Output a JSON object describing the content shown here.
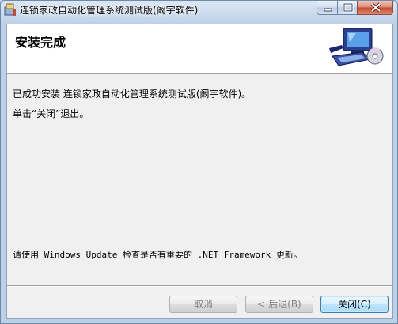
{
  "window": {
    "title": "连锁家政自动化管理系统测试版(阚宇软件)"
  },
  "banner": {
    "title": "安装完成"
  },
  "content": {
    "line1": "已成功安装 连锁家政自动化管理系统测试版(阚宇软件)。",
    "line2": "单击“关闭”退出。",
    "line3_prefix": "请使用 Windows Update 检查是否有重要的 .NET Framework 更新。"
  },
  "buttons": {
    "cancel": "取消",
    "back": "< 后退(B)",
    "close": "关闭(C)"
  },
  "icons": {
    "app": "installer-icon",
    "banner": "computer-cd-icon",
    "minimize": "minimize-icon",
    "maximize": "maximize-icon",
    "close": "close-icon"
  }
}
